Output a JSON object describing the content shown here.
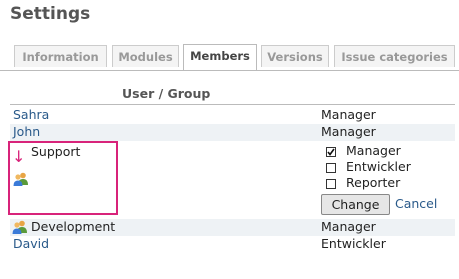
{
  "page": {
    "title": "Settings"
  },
  "tabs": [
    {
      "label": "Information"
    },
    {
      "label": "Modules"
    },
    {
      "label": "Members",
      "active": true
    },
    {
      "label": "Versions"
    },
    {
      "label": "Issue categories"
    }
  ],
  "table": {
    "header": "User / Group",
    "rows": [
      {
        "name": "Sahra",
        "role": "Manager"
      },
      {
        "name": "John",
        "role": "Manager"
      },
      {
        "name": "Support",
        "editor": {
          "roles": [
            {
              "label": "Manager",
              "checked": true
            },
            {
              "label": "Entwickler",
              "checked": false
            },
            {
              "label": "Reporter",
              "checked": false
            }
          ],
          "change_label": "Change",
          "cancel_label": "Cancel"
        }
      },
      {
        "name": "Development",
        "role": "Manager"
      },
      {
        "name": "David",
        "role": "Entwickler"
      }
    ]
  },
  "colors": {
    "link": "#2a5a8a",
    "highlight": "#d8237a"
  },
  "icons": {
    "group": "group-icon",
    "arrow": "down-arrow-icon"
  }
}
